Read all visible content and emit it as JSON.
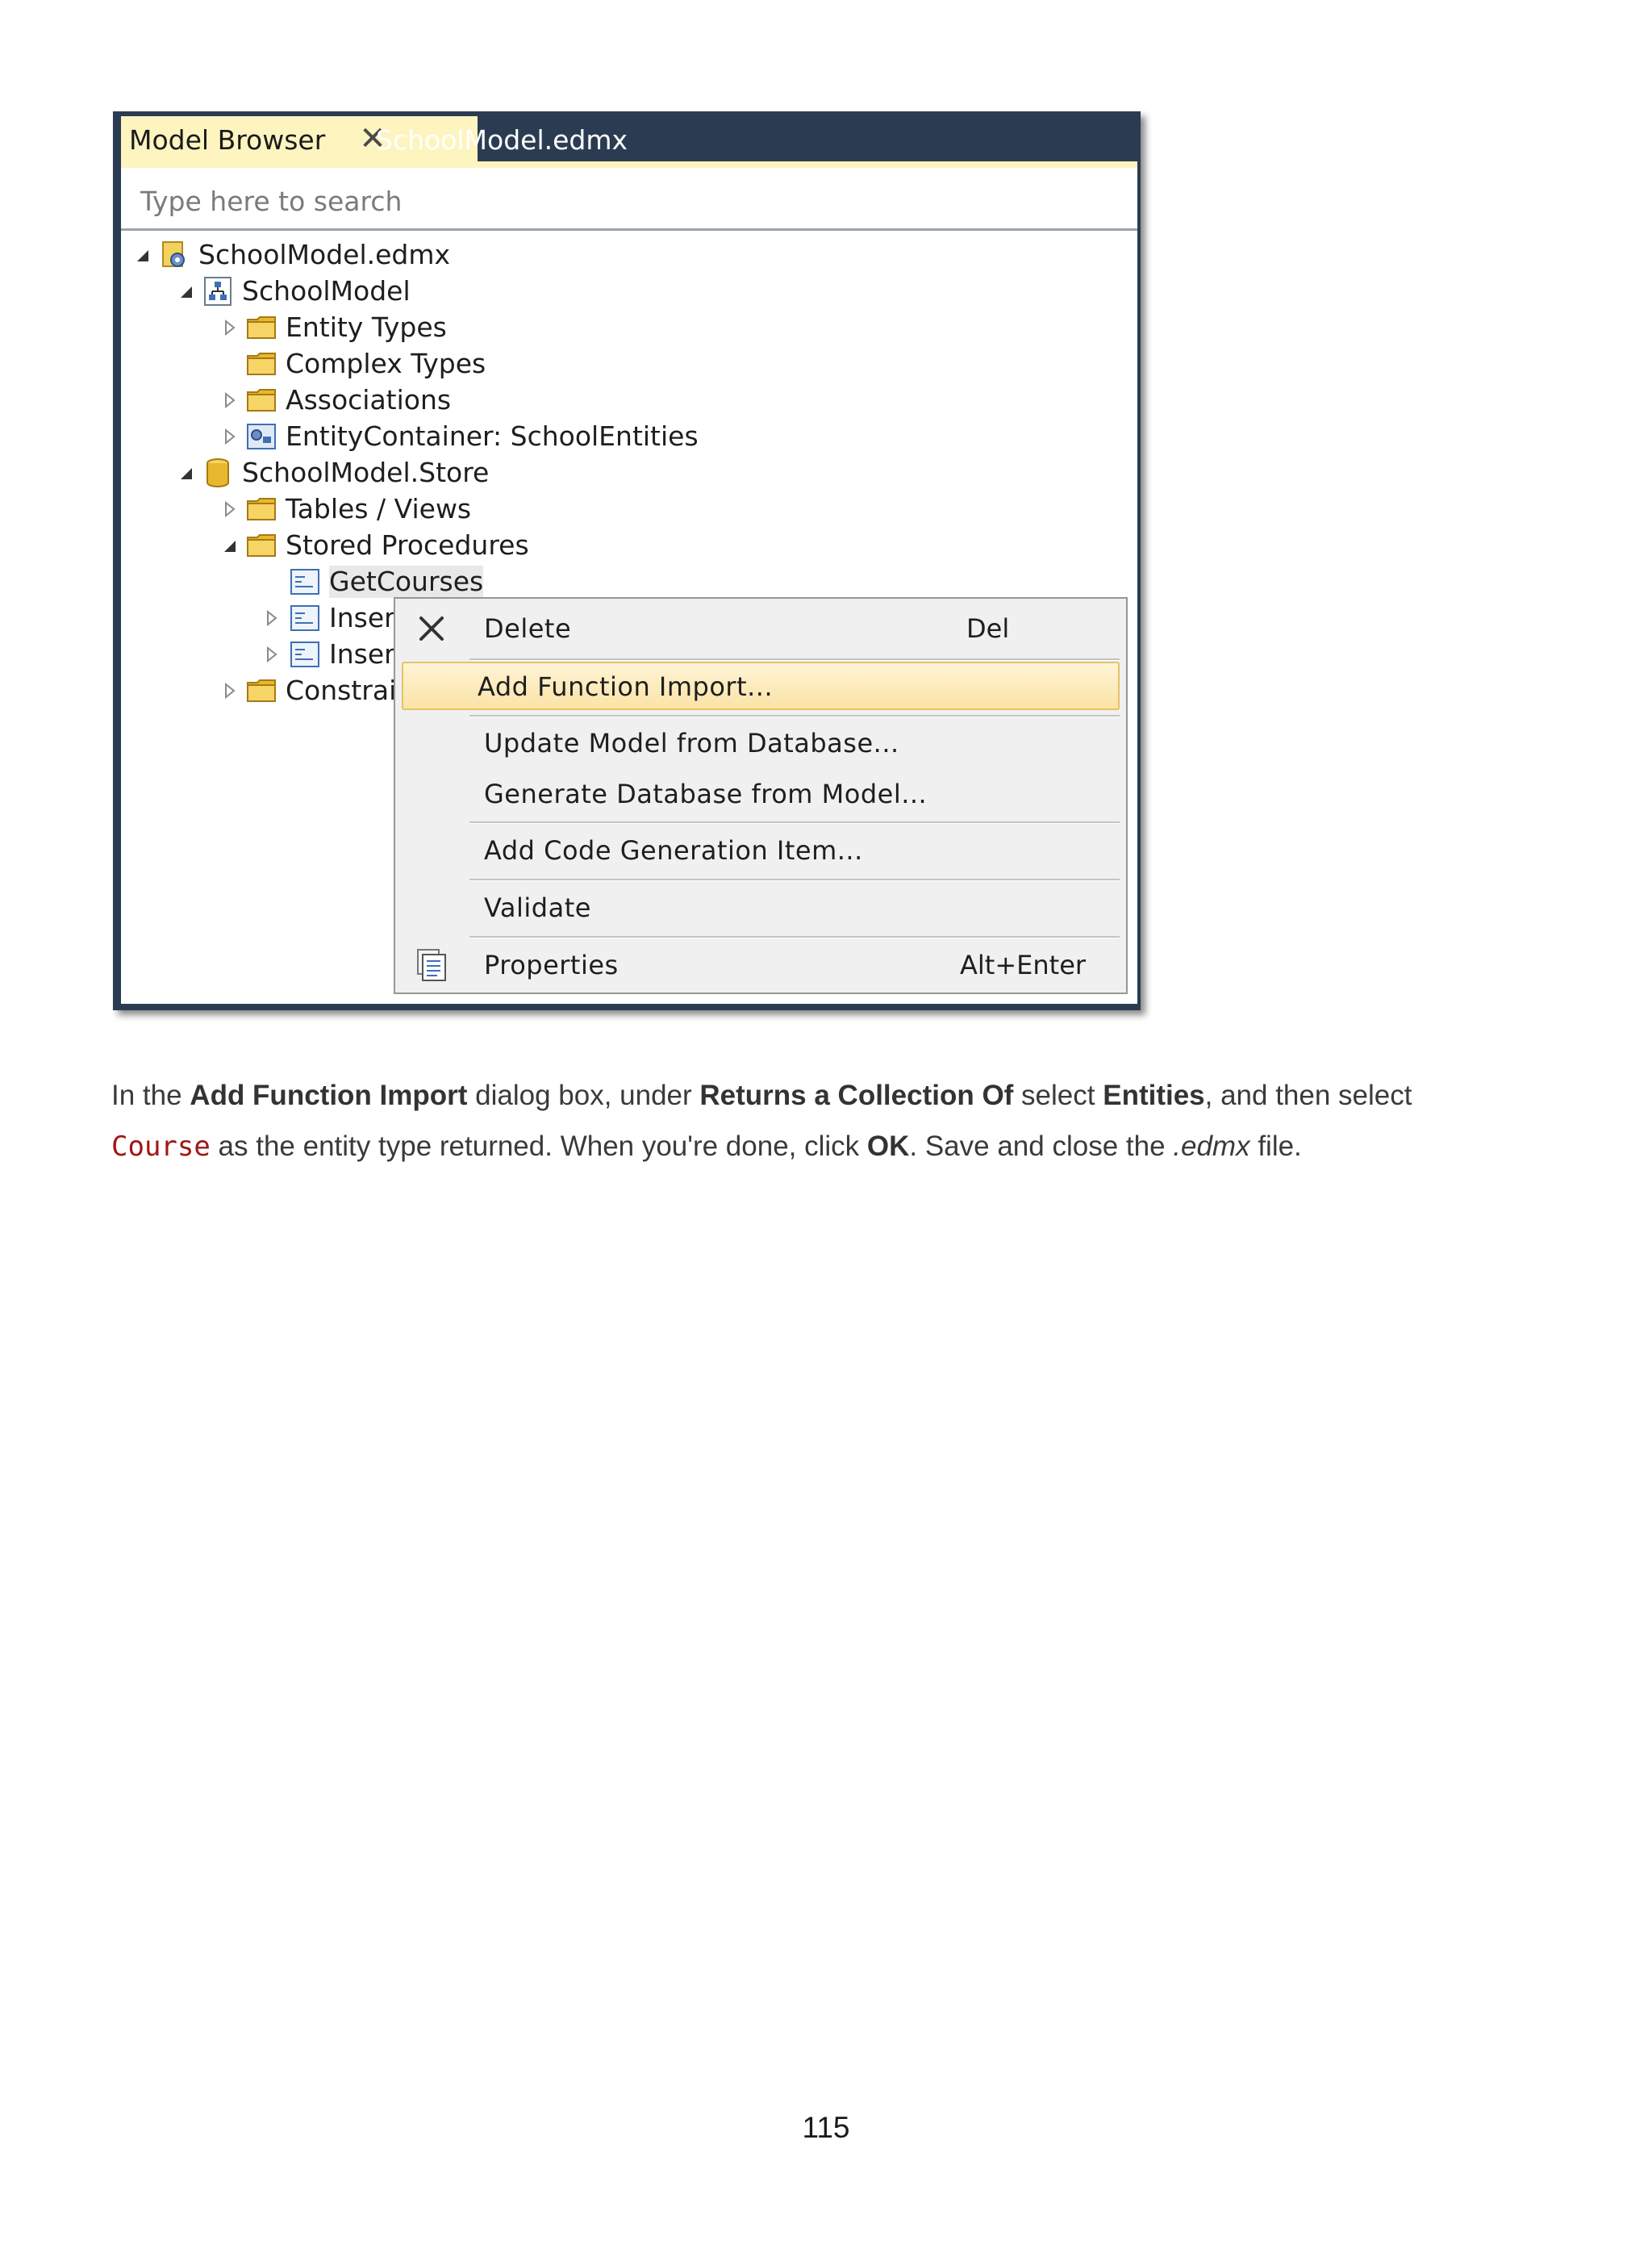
{
  "tabs": {
    "active_label": "Model Browser",
    "close_symbol": "✕",
    "inactive_label": "SchoolModel.edmx"
  },
  "search": {
    "placeholder": "Type here to search"
  },
  "tree": [
    {
      "label": "SchoolModel.edmx",
      "icon": "edmx-file-icon",
      "arrow": "expanded"
    },
    {
      "label": "SchoolModel",
      "icon": "model-icon",
      "arrow": "expanded"
    },
    {
      "label": "Entity Types",
      "icon": "folder-icon",
      "arrow": "collapsed"
    },
    {
      "label": "Complex Types",
      "icon": "folder-icon",
      "arrow": "none"
    },
    {
      "label": "Associations",
      "icon": "folder-icon",
      "arrow": "collapsed"
    },
    {
      "label": "EntityContainer: SchoolEntities",
      "icon": "entity-container-icon",
      "arrow": "collapsed"
    },
    {
      "label": "SchoolModel.Store",
      "icon": "database-icon",
      "arrow": "expanded"
    },
    {
      "label": "Tables / Views",
      "icon": "folder-icon",
      "arrow": "collapsed"
    },
    {
      "label": "Stored Procedures",
      "icon": "folder-icon",
      "arrow": "expanded"
    },
    {
      "label": "GetCourses",
      "icon": "stored-procedure-icon",
      "arrow": "none"
    },
    {
      "label": "Inser",
      "icon": "stored-procedure-icon",
      "arrow": "collapsed"
    },
    {
      "label": "Inser",
      "icon": "stored-procedure-icon",
      "arrow": "collapsed"
    },
    {
      "label": "Constrai",
      "icon": "folder-icon",
      "arrow": "collapsed"
    }
  ],
  "context_menu": {
    "items": [
      {
        "label": "Delete",
        "shortcut": "Del",
        "icon": "delete-x-icon"
      },
      {
        "label": "Add Function Import...",
        "shortcut": ""
      },
      {
        "label": "Update Model from Database...",
        "shortcut": ""
      },
      {
        "label": "Generate Database from Model...",
        "shortcut": ""
      },
      {
        "label": "Add Code Generation Item...",
        "shortcut": ""
      },
      {
        "label": "Validate",
        "shortcut": ""
      },
      {
        "label": "Properties",
        "shortcut": "Alt+Enter",
        "icon": "properties-icon"
      }
    ],
    "highlight_color": "#fbe3a6"
  },
  "paragraph": {
    "t1": "In the ",
    "b1": "Add Function Import",
    "t2": " dialog box, under ",
    "b2": "Returns a Collection Of",
    "t3": " select ",
    "b3": "Entities",
    "t4": ", and then select",
    "code1": "Course",
    "t5": " as the entity type returned. When you're done, click ",
    "b4": "OK",
    "t6": ". Save and close the ",
    "i1": ".edmx",
    "t7": " file."
  },
  "page_number": "115"
}
